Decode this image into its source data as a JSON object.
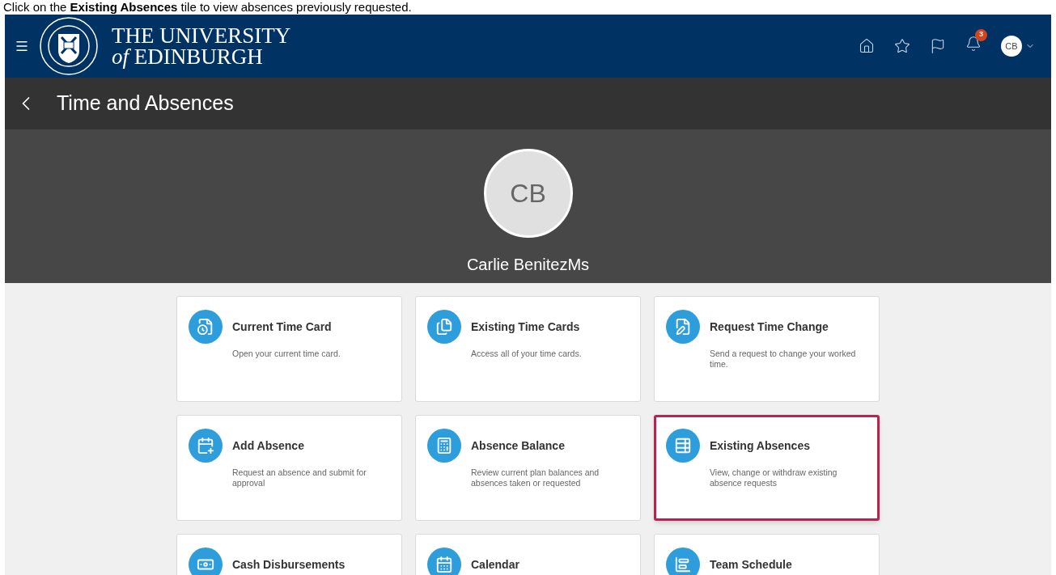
{
  "caption": "Click on the **Existing Absences** tile to view absences previously requested.",
  "header": {
    "logo_line1": "THE UNIVERSITY",
    "logo_line2_italic": "of",
    "logo_line2": "EDINBURGH",
    "notification_count": "3",
    "avatar": "CB"
  },
  "page_title": "Time and Absences",
  "profile": {
    "initials": "CB",
    "name": "Carlie BenitezMs"
  },
  "tiles": [
    {
      "title": "Current Time Card",
      "description": "Open your current time card.",
      "highlighted": false
    },
    {
      "title": "Existing Time Cards",
      "description": "Access all of your time cards.",
      "highlighted": false
    },
    {
      "title": "Request Time Change",
      "description": "Send a request to change your worked time.",
      "highlighted": false
    },
    {
      "title": "Add Absence",
      "description": "Request an absence and submit for approval",
      "highlighted": false
    },
    {
      "title": "Absence Balance",
      "description": "Review current plan balances and absences taken or requested",
      "highlighted": false
    },
    {
      "title": "Existing Absences",
      "description": "View, change or withdraw existing absence requests",
      "highlighted": true
    },
    {
      "title": "Cash Disbursements",
      "highlighted": false
    },
    {
      "title": "Calendar",
      "highlighted": false
    },
    {
      "title": "Team Schedule",
      "highlighted": false
    }
  ]
}
